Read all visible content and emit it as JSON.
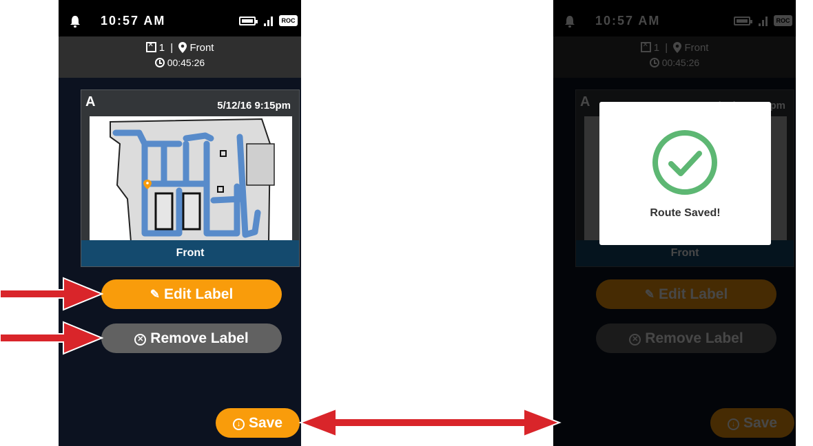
{
  "status": {
    "time": "10:57 AM",
    "network_badge": "ROC"
  },
  "info": {
    "floor": "1",
    "separator": "|",
    "location": "Front",
    "elapsed": "00:45:26"
  },
  "card": {
    "letter": "A",
    "date": "5/12/16 9:15pm",
    "label": "Front"
  },
  "buttons": {
    "edit": "Edit Label",
    "remove": "Remove Label",
    "save": "Save"
  },
  "modal": {
    "message": "Route Saved!"
  },
  "colors": {
    "accent": "#f99c0b",
    "secondary_button": "#616161",
    "label_bar": "#144a6e",
    "success": "#5db773",
    "annotation_arrow": "#d9252a"
  },
  "icons": [
    "bell-icon",
    "battery-icon",
    "signal-icon",
    "floorplan-icon",
    "location-pin-icon",
    "clock-icon",
    "pencil-icon",
    "remove-circle-icon",
    "download-circle-icon",
    "checkmark-circle-icon"
  ]
}
